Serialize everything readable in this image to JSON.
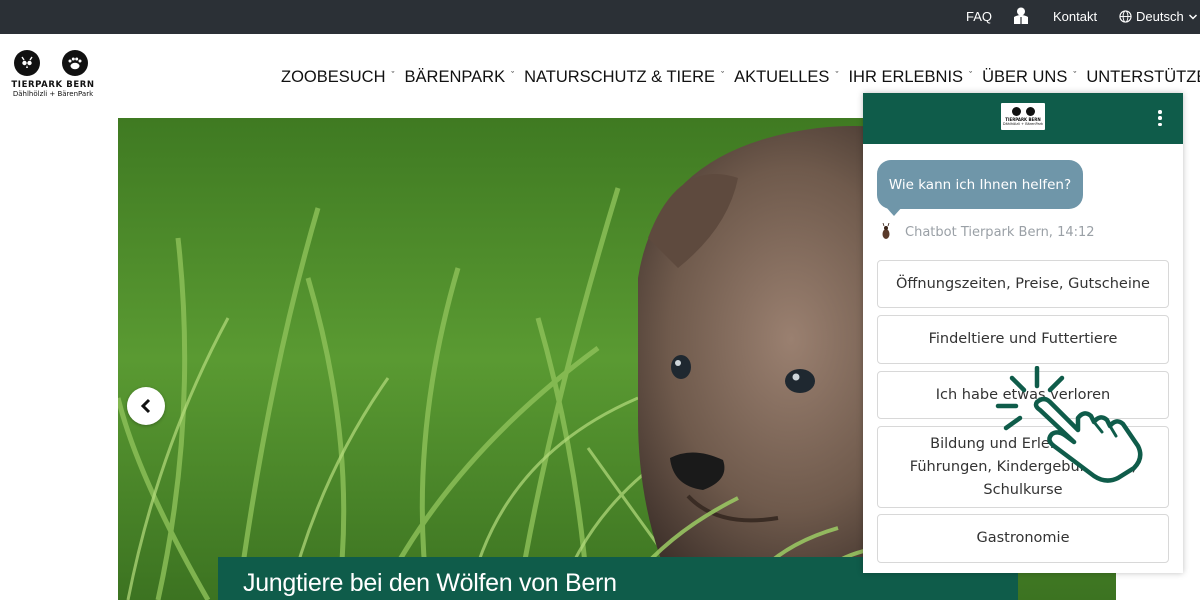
{
  "topbar": {
    "faq": "FAQ",
    "kontakt": "Kontakt",
    "language": "Deutsch",
    "icons": [
      "user-icon",
      "globe-icon",
      "chevron-down-icon"
    ]
  },
  "logo": {
    "name": "TIERPARK BERN",
    "sub": "Dählhölzli + BärenPark"
  },
  "nav": {
    "items": [
      {
        "label": "ZOOBESUCH"
      },
      {
        "label": "BÄRENPARK"
      },
      {
        "label": "NATURSCHUTZ & TIERE"
      },
      {
        "label": "AKTUELLES"
      },
      {
        "label": "IHR ERLEBNIS"
      },
      {
        "label": "ÜBER UNS"
      },
      {
        "label": "UNTERSTÜTZEN"
      }
    ]
  },
  "hero": {
    "caption": "Jungtiere bei den Wölfen von Bern"
  },
  "chat": {
    "greeting": "Wie kann ich Ihnen helfen?",
    "meta": "Chatbot Tierpark Bern, 14:12",
    "options": [
      "Öffnungszeiten, Preise, Gutscheine",
      "Findeltiere und Futtertiere",
      "Ich habe etwas verloren",
      "Bildung und Erlebnis, z.B. Führungen, Kindergeburtstage, Schulkurse",
      "Gastronomie"
    ],
    "header_color": "#0f5c4a",
    "bubble_color": "#6f96a9"
  },
  "colors": {
    "topbar": "#2b3036",
    "brand_green": "#0f5c4a"
  }
}
